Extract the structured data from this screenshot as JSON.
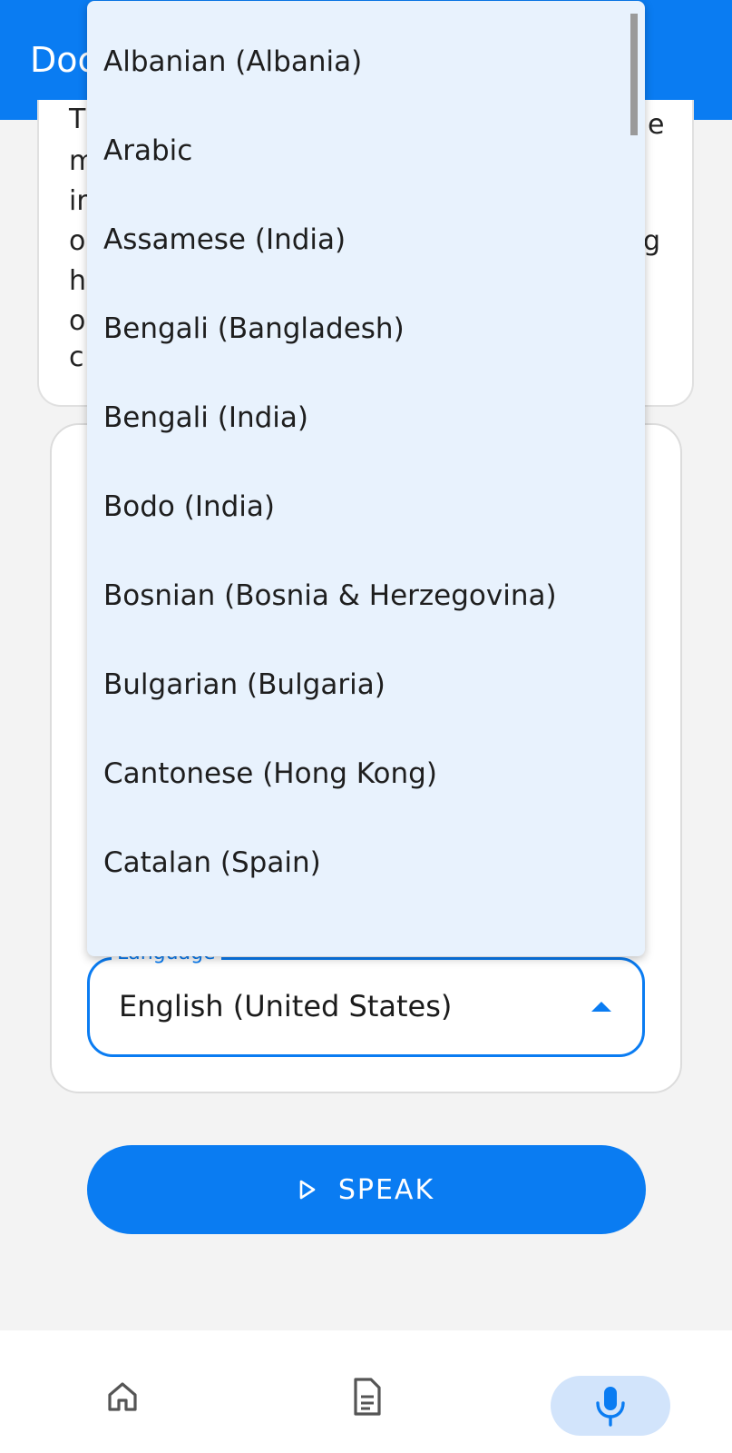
{
  "app_bar": {
    "title": "Doc"
  },
  "text_card": {
    "lines": [
      "T",
      "m",
      "ir",
      "o",
      "h",
      "o",
      "c"
    ],
    "right_fragments": [
      "e",
      "g"
    ]
  },
  "language_field": {
    "label": "Language",
    "value": "English (United States)"
  },
  "dropdown": {
    "items": [
      "Albanian (Albania)",
      "Arabic",
      "Assamese (India)",
      "Bengali (Bangladesh)",
      "Bengali (India)",
      "Bodo (India)",
      "Bosnian (Bosnia & Herzegovina)",
      "Bulgarian (Bulgaria)",
      "Cantonese (Hong Kong)",
      "Catalan (Spain)"
    ]
  },
  "speak_button": {
    "label": "SPEAK",
    "icon": "play-icon"
  },
  "bottom_nav": {
    "items": [
      {
        "name": "home",
        "icon": "home-icon"
      },
      {
        "name": "document",
        "icon": "document-icon"
      },
      {
        "name": "microphone",
        "icon": "microphone-icon",
        "active": true
      }
    ]
  },
  "colors": {
    "primary": "#0a7cf2",
    "menu_bg": "#e8f2fd",
    "active_pill": "#d2e4fb"
  }
}
